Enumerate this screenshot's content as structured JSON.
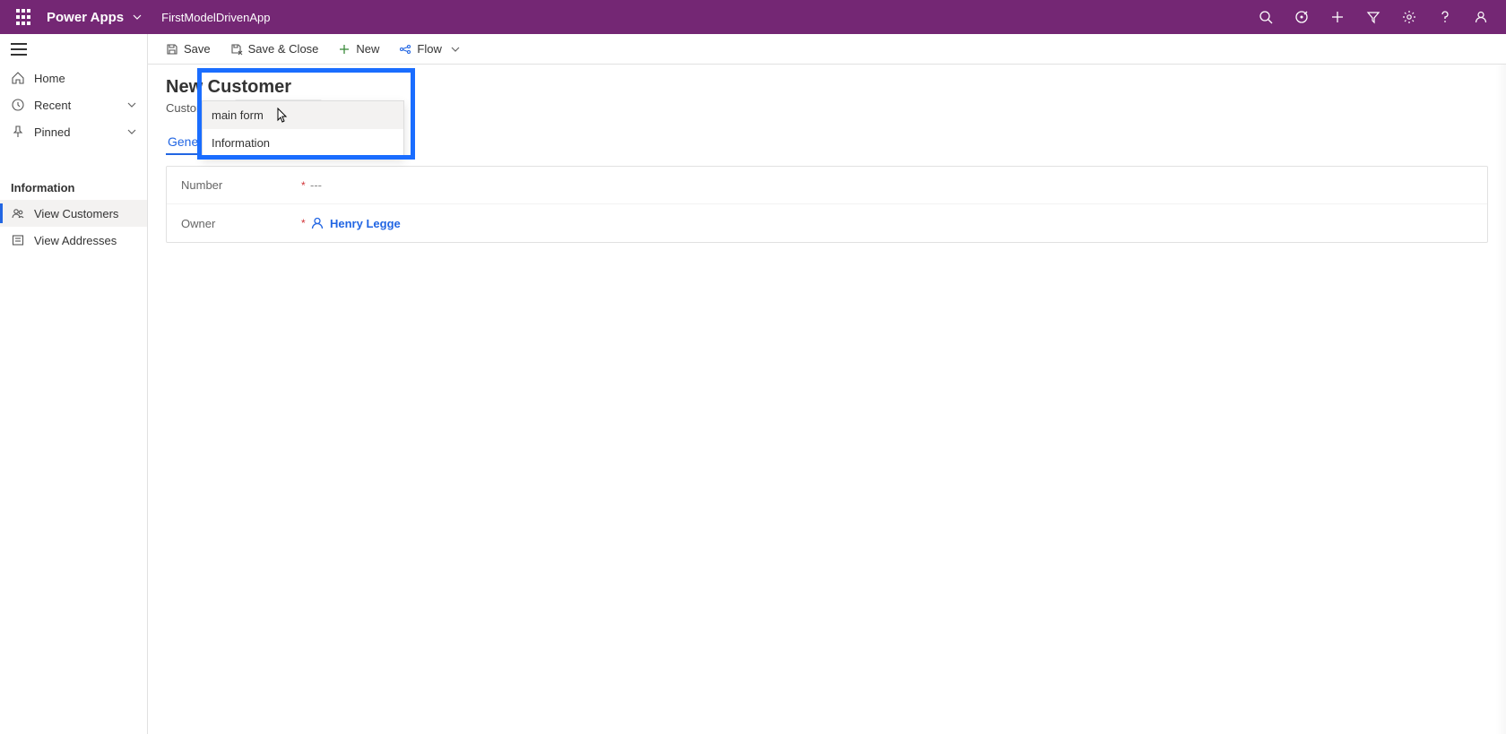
{
  "topbar": {
    "brand": "Power Apps",
    "app_name": "FirstModelDrivenApp"
  },
  "leftnav": {
    "items_top": [
      {
        "icon": "home",
        "label": "Home"
      },
      {
        "icon": "clock",
        "label": "Recent",
        "expandable": true
      },
      {
        "icon": "pin",
        "label": "Pinned",
        "expandable": true
      }
    ],
    "group_label": "Information",
    "items_group": [
      {
        "icon": "people",
        "label": "View Customers",
        "active": true
      },
      {
        "icon": "address",
        "label": "View Addresses"
      }
    ]
  },
  "commands": {
    "save": "Save",
    "save_close": "Save & Close",
    "new": "New",
    "flow": "Flow"
  },
  "page": {
    "title": "New Customer",
    "entity": "Customer",
    "form_selector_label": "Information",
    "tab_general": "General"
  },
  "dropdown": {
    "item1": "main form",
    "item2": "Information"
  },
  "form": {
    "number_label": "Number",
    "number_value": "---",
    "owner_label": "Owner",
    "owner_value": "Henry Legge"
  }
}
